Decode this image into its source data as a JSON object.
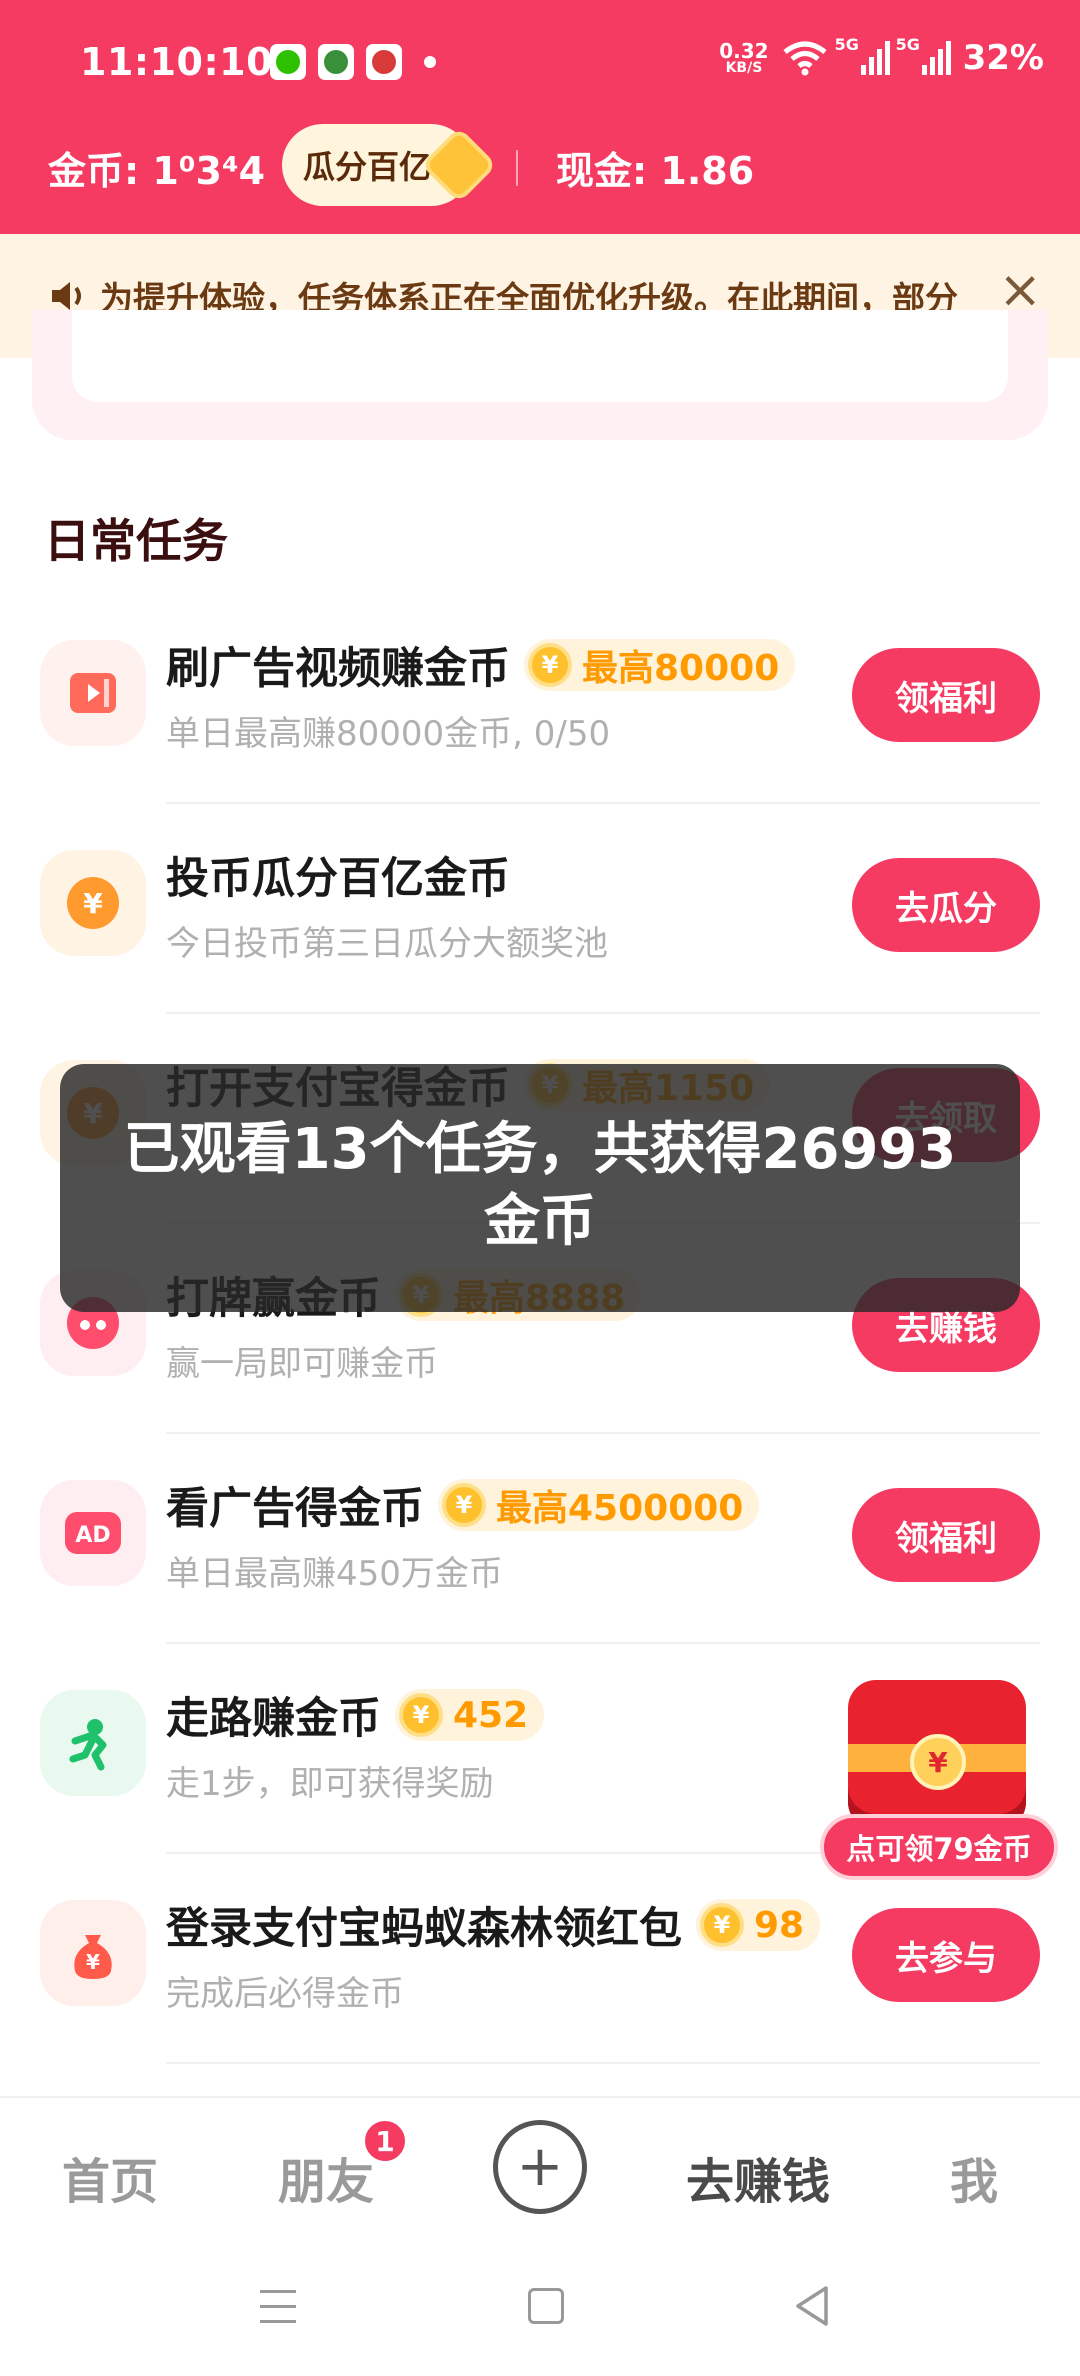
{
  "status_bar": {
    "time": "11:10:10",
    "net_speed_value": "0.32",
    "net_speed_unit": "KB/S",
    "signal1_label": "5G",
    "signal2_label": "5G",
    "battery": "32%"
  },
  "header": {
    "coins_label": "金币: 1⁣3⁣4",
    "coins_display": "金币: 1⁰3⁴4",
    "promo_pill": "瓜分百亿",
    "cash_label": "现金: 1.86"
  },
  "notice": {
    "text": "为提升体验，任务体系正在全面优化升级。在此期间，部分"
  },
  "section_title": "日常任务",
  "tasks": [
    {
      "title": "刷广告视频赚金币",
      "reward": "最高80000",
      "subtitle": "单日最高赚80000金币, 0/50",
      "button": "领福利",
      "icon": "video-play-icon",
      "color": "#ff6a5a"
    },
    {
      "title": "投币瓜分百亿金币",
      "reward": "",
      "subtitle": "今日投币第三日瓜分大额奖池",
      "button": "去瓜分",
      "icon": "yuan-coin-icon",
      "color": "#ff9a2e"
    },
    {
      "title": "打开支付宝得金币",
      "reward": "最高1150",
      "subtitle": "",
      "button": "去领取",
      "icon": "yuan-coin-icon",
      "color": "#ff9a2e"
    },
    {
      "title": "打牌赢金币",
      "reward": "最高8888",
      "subtitle": "赢一局即可赚金币",
      "button": "去赚钱",
      "icon": "cards-icon",
      "color": "#ff4d6d"
    },
    {
      "title": "看广告得金币",
      "reward": "最高4500000",
      "subtitle": "单日最高赚450万金币",
      "button": "领福利",
      "icon": "ad-icon",
      "color": "#ff4d6d"
    },
    {
      "title": "走路赚金币",
      "reward": "452",
      "subtitle": "走1步，即可获得奖励",
      "button": "",
      "icon": "running-icon",
      "color": "#1fc26a"
    },
    {
      "title": "登录支付宝蚂蚁森林领红包",
      "reward": "98",
      "subtitle": "完成后必得金币",
      "button": "去参与",
      "icon": "money-bag-icon",
      "color": "#ff5a4a"
    }
  ],
  "toast": {
    "text": "已观看13个任务，共获得26993金币"
  },
  "floating_reward": {
    "label": "点可领79金币",
    "coin_symbol": "¥"
  },
  "bottom_nav": {
    "home": "首页",
    "friends": "朋友",
    "friends_badge": "1",
    "plus": "+",
    "earn": "去赚钱",
    "me": "我"
  },
  "coin_symbol": "¥"
}
